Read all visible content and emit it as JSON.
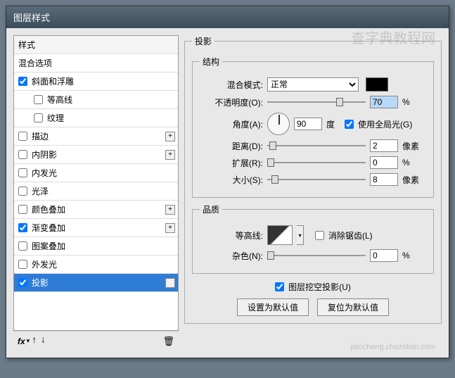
{
  "window": {
    "title": "图层样式"
  },
  "sidebar": {
    "header": "样式",
    "blend_options": "混合选项",
    "items": [
      {
        "label": "斜面和浮雕",
        "checked": true,
        "plus": false
      },
      {
        "label": "等高线",
        "checked": false,
        "indent": true
      },
      {
        "label": "纹理",
        "checked": false,
        "indent": true
      },
      {
        "label": "描边",
        "checked": false,
        "plus": true
      },
      {
        "label": "内阴影",
        "checked": false,
        "plus": true
      },
      {
        "label": "内发光",
        "checked": false
      },
      {
        "label": "光泽",
        "checked": false
      },
      {
        "label": "颜色叠加",
        "checked": false,
        "plus": true
      },
      {
        "label": "渐变叠加",
        "checked": true,
        "plus": true
      },
      {
        "label": "图案叠加",
        "checked": false
      },
      {
        "label": "外发光",
        "checked": false
      },
      {
        "label": "投影",
        "checked": true,
        "plus": true,
        "selected": true
      }
    ],
    "footer_fx": "fx"
  },
  "panel": {
    "title": "投影",
    "structure": {
      "legend": "结构",
      "blend_mode_label": "混合模式:",
      "blend_mode_value": "正常",
      "opacity_label": "不透明度(O):",
      "opacity_value": "70",
      "opacity_unit": "%",
      "angle_label": "角度(A):",
      "angle_value": "90",
      "angle_unit": "度",
      "global_light_label": "使用全局光(G)",
      "distance_label": "距离(D):",
      "distance_value": "2",
      "distance_unit": "像素",
      "spread_label": "扩展(R):",
      "spread_value": "0",
      "spread_unit": "%",
      "size_label": "大小(S):",
      "size_value": "8",
      "size_unit": "像素"
    },
    "quality": {
      "legend": "品质",
      "contour_label": "等高线:",
      "antialias_label": "消除锯齿(L)",
      "noise_label": "杂色(N):",
      "noise_value": "0",
      "noise_unit": "%"
    },
    "knockout_label": "图层挖空投影(U)",
    "make_default": "设置为默认值",
    "reset_default": "复位为默认值"
  },
  "watermark": "查字典教程网",
  "watermark2": "jiaocheng.chazidian.com"
}
